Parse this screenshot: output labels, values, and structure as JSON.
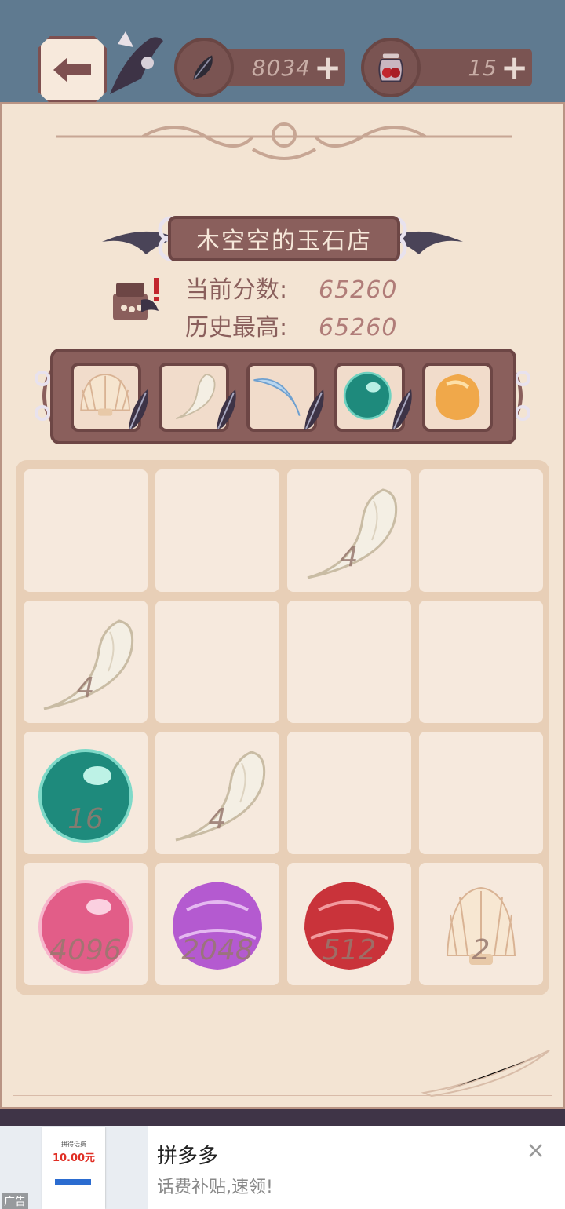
{
  "header": {
    "feathers": "8034",
    "jars": "15",
    "plus": "+"
  },
  "shop": {
    "title": "木空空的玉石店",
    "current_label": "当前分数:",
    "current_score": "65260",
    "best_label": "历史最高:",
    "best_score": "65260"
  },
  "preview_items": [
    "shell",
    "claw",
    "crescent-blade",
    "teal-orb",
    "amber-drop"
  ],
  "board": {
    "rows": [
      [
        "",
        "",
        "4",
        ""
      ],
      [
        "4",
        "",
        "",
        ""
      ],
      [
        "16",
        "4",
        "",
        ""
      ],
      [
        "4096",
        "2048",
        "512",
        "2"
      ]
    ]
  },
  "ad": {
    "title": "拼多多",
    "subtitle": "话费补贴,速领!",
    "tag": "广告",
    "card_small": "拼得话费",
    "card_amount": "10.00元",
    "close": "×"
  },
  "colors": {
    "frame": "#8a5f5c",
    "paper": "#f3e4d3",
    "cell": "#f6e9dd"
  }
}
